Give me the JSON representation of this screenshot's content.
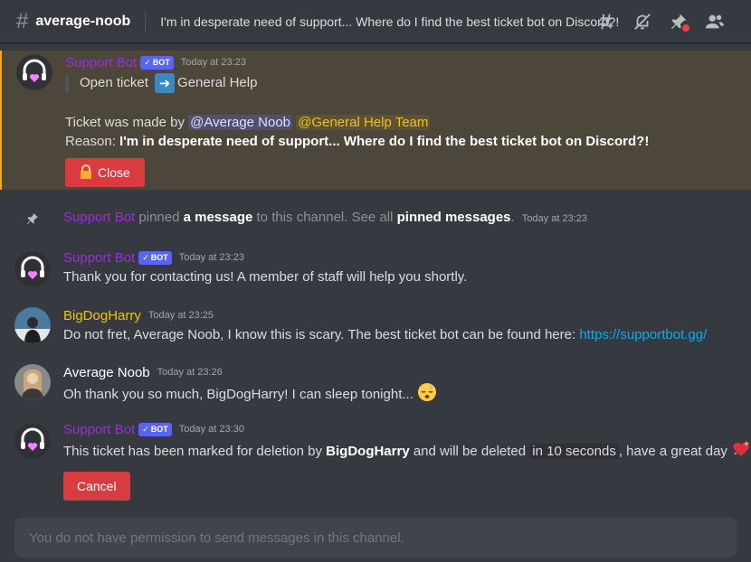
{
  "header": {
    "channel_name": "average-noob",
    "topic": "I'm in desperate need of support... Where do I find the best ticket bot on Discord?!",
    "icons": [
      "threads-icon",
      "mute-bell-icon",
      "pin-icon",
      "members-icon"
    ]
  },
  "msg1": {
    "author": "Support Bot",
    "bot_tag": "BOT",
    "timestamp": "Today at 23:23",
    "quote_prefix": "Open ticket",
    "quote_suffix": "General Help",
    "made_by_prefix": "Ticket was made by ",
    "mention_user": "@Average Noob",
    "mention_role": "@General Help Team",
    "reason_label": "Reason: ",
    "reason_text": "I'm in desperate need of support... Where do I find the best ticket bot on Discord?!",
    "button_label": "Close"
  },
  "system": {
    "author": "Support Bot",
    "pinned": "pinned",
    "a_message": "a message",
    "middle": "to this channel. See all",
    "pinned_messages": "pinned messages",
    "period": ".",
    "timestamp": "Today at 23:23"
  },
  "msg2": {
    "author": "Support Bot",
    "bot_tag": "BOT",
    "timestamp": "Today at 23:23",
    "text": "Thank you for contacting us! A member of staff will help you shortly."
  },
  "msg3": {
    "author": "BigDogHarry",
    "timestamp": "Today at 23:25",
    "text": "Do not fret, Average Noob, I know this is scary. The best ticket bot can be found here:",
    "link": "https://supportbot.gg/"
  },
  "msg4": {
    "author": "Average Noob",
    "timestamp": "Today at 23:26",
    "text": "Oh thank you so much, BigDogHarry! I can sleep tonight..."
  },
  "msg5": {
    "author": "Support Bot",
    "bot_tag": "BOT",
    "timestamp": "Today at 23:30",
    "text_a": "This ticket has been marked for deletion by ",
    "text_bold": "BigDogHarry",
    "text_b": " and will be deleted ",
    "text_code": "in 10 seconds",
    "text_c": ", have a great day",
    "button_label": "Cancel"
  },
  "composer": {
    "placeholder": "You do not have permission to send messages in this channel."
  },
  "colors": {
    "background": "#36393f",
    "bot_name": "#9b2fd6",
    "harry_name": "#f1c40f",
    "highlight": "#4d463a",
    "danger": "#d83c3e",
    "link": "#00aff4",
    "bot_tag": "#5865f2"
  }
}
